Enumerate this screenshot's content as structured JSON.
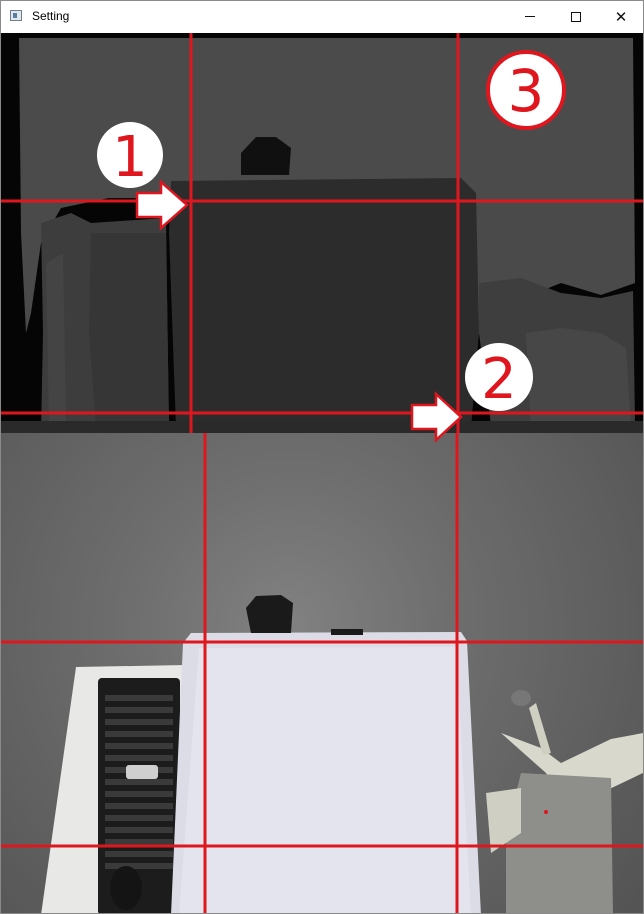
{
  "window": {
    "title": "Setting",
    "icon": "app-window-icon",
    "controls": {
      "minimize": "minimize-icon",
      "maximize": "maximize-icon",
      "close_glyph": "✕"
    }
  },
  "annotations": [
    {
      "label": "1"
    },
    {
      "label": "2"
    },
    {
      "label": "3"
    }
  ],
  "colors": {
    "grid_line": "#e0161e",
    "marker_outline": "#e0161e",
    "marker_fill": "#ffffff"
  }
}
